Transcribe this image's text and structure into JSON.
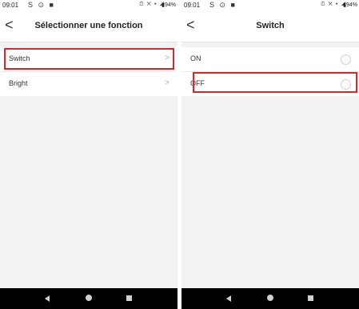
{
  "left_screen": {
    "status": {
      "time": "09:01",
      "left_icons": "S ⊙ ■",
      "right_icons": "⏱ ✕ ▾ ◢",
      "battery": "▮94%"
    },
    "header": {
      "back": "<",
      "title": "Sélectionner une fonction"
    },
    "items": [
      {
        "label": "Switch",
        "chevron": ">"
      },
      {
        "label": "Bright",
        "chevron": ">"
      }
    ]
  },
  "right_screen": {
    "status": {
      "time": "09:01",
      "left_icons": "S ⊙ ■",
      "right_icons": "⏱ ✕ ▾ ◢",
      "battery": "▮94%"
    },
    "header": {
      "back": "<",
      "title": "Switch"
    },
    "items": [
      {
        "label": "ON"
      },
      {
        "label": "OFF"
      }
    ]
  },
  "colors": {
    "highlight": "#d8282a",
    "background": "#f2f2f2",
    "navbar": "#000000"
  },
  "icons": [
    "back-arrow-icon",
    "chevron-right-icon",
    "radio-icon",
    "nav-back-icon",
    "nav-home-icon",
    "nav-recent-icon"
  ]
}
